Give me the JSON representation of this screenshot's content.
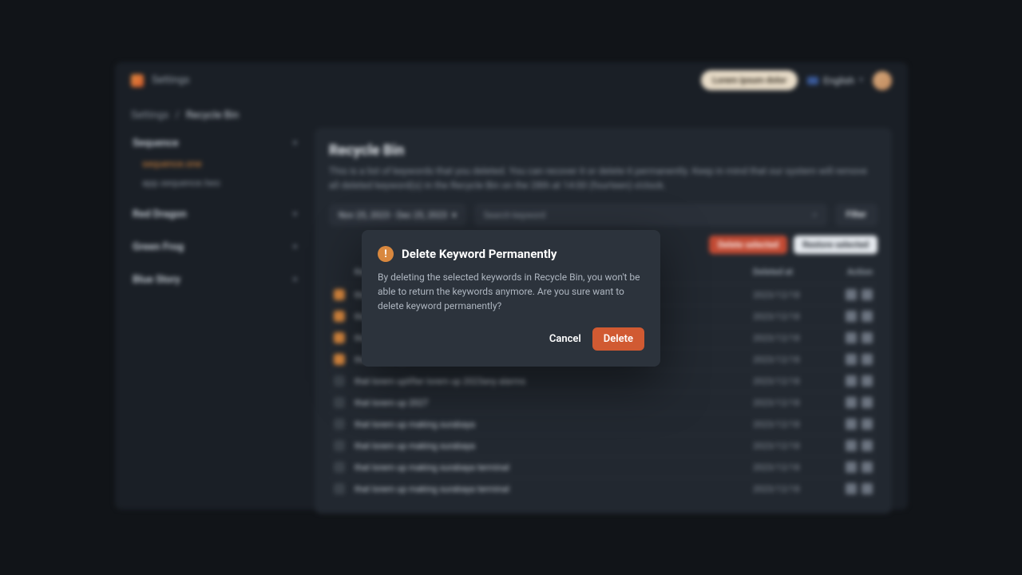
{
  "app": {
    "title": "Settings",
    "cta": "Lorem ipsum dolor",
    "language": "English"
  },
  "breadcrumb": {
    "root": "Settings",
    "sep": "/",
    "current": "Recycle Bin"
  },
  "sidebar": {
    "groups": [
      {
        "title": "Sequence",
        "items": [
          {
            "label": "sequence.one",
            "active": true
          },
          {
            "label": "app.sequence.two",
            "active": false
          }
        ]
      },
      {
        "title": "Red Dragon",
        "items": []
      },
      {
        "title": "Green Frog",
        "items": []
      },
      {
        "title": "Blue Story",
        "items": []
      }
    ]
  },
  "main": {
    "title": "Recycle Bin",
    "description": "This is a list of keywords that you deleted. You can recover it or delete it permanently. Keep in mind that our system will remove all deleted keyword(s) in the Recycle Bin on the 28th at 14:00 (fourteen) o'clock.",
    "date_range": "Nov 25, 2023 - Dec 25, 2023",
    "search_placeholder": "Search keyword",
    "filter_btn": "Filter",
    "delete_selected": "Delete selected",
    "restore_selected": "Restore selected",
    "columns": {
      "keyword": "Keyword",
      "deleted_at": "Deleted at",
      "action": "Action"
    },
    "rows": [
      {
        "checked": true,
        "keyword": "that lorem up",
        "date": "2023/12/18"
      },
      {
        "checked": true,
        "keyword": "that lorem up",
        "date": "2023/12/18"
      },
      {
        "checked": true,
        "keyword": "that lorem up",
        "date": "2023/12/18"
      },
      {
        "checked": true,
        "keyword": "that lorem up",
        "date": "2023/12/18"
      },
      {
        "checked": false,
        "keyword": "that lorem uplifter lorem up 2023any alarms",
        "date": "2023/12/18"
      },
      {
        "checked": false,
        "keyword": "that lorem up 2027",
        "date": "2023/12/18"
      },
      {
        "checked": false,
        "keyword": "that lorem up making surabaya",
        "date": "2023/12/18"
      },
      {
        "checked": false,
        "keyword": "that lorem up making surabaya",
        "date": "2023/12/18"
      },
      {
        "checked": false,
        "keyword": "that lorem up making surabaya terminal",
        "date": "2023/12/18"
      },
      {
        "checked": false,
        "keyword": "that lorem up making surabaya terminal",
        "date": "2023/12/18"
      }
    ]
  },
  "modal": {
    "title": "Delete Keyword Permanently",
    "body": "By deleting the selected keywords in Recycle Bin, you won't be able to return the keywords anymore. Are you sure want to delete keyword permanently?",
    "cancel": "Cancel",
    "confirm": "Delete"
  }
}
